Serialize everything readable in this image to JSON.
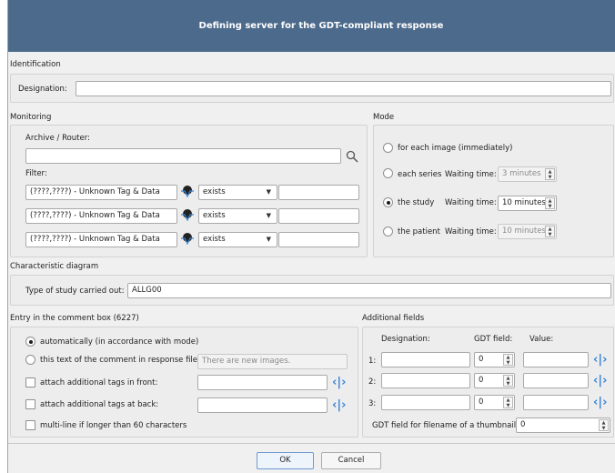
{
  "dialog": {
    "title": "Defining server for the GDT-compliant response",
    "ok_label": "OK",
    "cancel_label": "Cancel"
  },
  "identification": {
    "section_label": "Identification",
    "designation_label": "Designation:",
    "designation_value": ""
  },
  "monitoring": {
    "section_label": "Monitoring",
    "archive_label": "Archive / Router:",
    "archive_value": "",
    "filter_label": "Filter:",
    "filters": [
      {
        "tag": "(????,????) - Unknown Tag & Data",
        "op": "exists",
        "value": ""
      },
      {
        "tag": "(????,????) - Unknown Tag & Data",
        "op": "exists",
        "value": ""
      },
      {
        "tag": "(????,????) - Unknown Tag & Data",
        "op": "exists",
        "value": ""
      }
    ]
  },
  "mode": {
    "section_label": "Mode",
    "options": [
      {
        "label": "for each image (immediately)",
        "checked": false,
        "has_wait": false
      },
      {
        "label": "each series",
        "checked": false,
        "has_wait": true,
        "wait_label": "Waiting time:",
        "wait_value": "3 minutes",
        "enabled": false
      },
      {
        "label": "the study",
        "checked": true,
        "has_wait": true,
        "wait_label": "Waiting time:",
        "wait_value": "10 minutes",
        "enabled": true
      },
      {
        "label": "the patient",
        "checked": false,
        "has_wait": true,
        "wait_label": "Waiting time:",
        "wait_value": "10 minutes",
        "enabled": false
      }
    ]
  },
  "characteristic": {
    "section_label": "Characteristic diagram",
    "type_label": "Type of study carried out:",
    "type_value": "ALLG00"
  },
  "comment": {
    "section_label": "Entry in the comment box (6227)",
    "auto_label": "automatically (in accordance with mode)",
    "text_label": "this text of the comment in response file:",
    "text_placeholder": "There are new images.",
    "front_label": "attach additional tags in front:",
    "back_label": "attach additional tags at back:",
    "multiline_label": "multi-line if longer than 60 characters"
  },
  "additional": {
    "section_label": "Additional fields",
    "col_designation": "Designation:",
    "col_gdt": "GDT field:",
    "col_value": "Value:",
    "rows": [
      {
        "num": "1:",
        "designation": "",
        "gdt": "0",
        "value": ""
      },
      {
        "num": "2:",
        "designation": "",
        "gdt": "0",
        "value": ""
      },
      {
        "num": "3:",
        "designation": "",
        "gdt": "0",
        "value": ""
      }
    ],
    "thumb_label": "GDT field for filename of a thumbnail:",
    "thumb_value": "0"
  },
  "icons": {
    "search": "search-icon",
    "tag_picker": "tag-picker-icon",
    "expand_arrows": "expand-arrows-icon",
    "accent": "#3b86d6",
    "title_bg": "#4c6a8b"
  }
}
